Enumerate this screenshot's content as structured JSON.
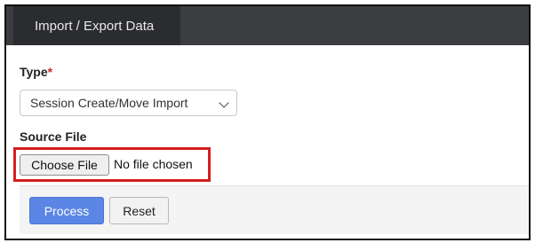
{
  "header": {
    "tab_label": "Import / Export Data"
  },
  "form": {
    "type_label": "Type",
    "required_marker": "*",
    "type_selected": "Session Create/Move Import",
    "source_label": "Source File",
    "choose_file_label": "Choose File",
    "file_status": "No file chosen"
  },
  "actions": {
    "process_label": "Process",
    "reset_label": "Reset"
  },
  "colors": {
    "highlight": "#d31f1f",
    "primary_button": "#5b86e5",
    "header_bar": "#3b3d40"
  }
}
